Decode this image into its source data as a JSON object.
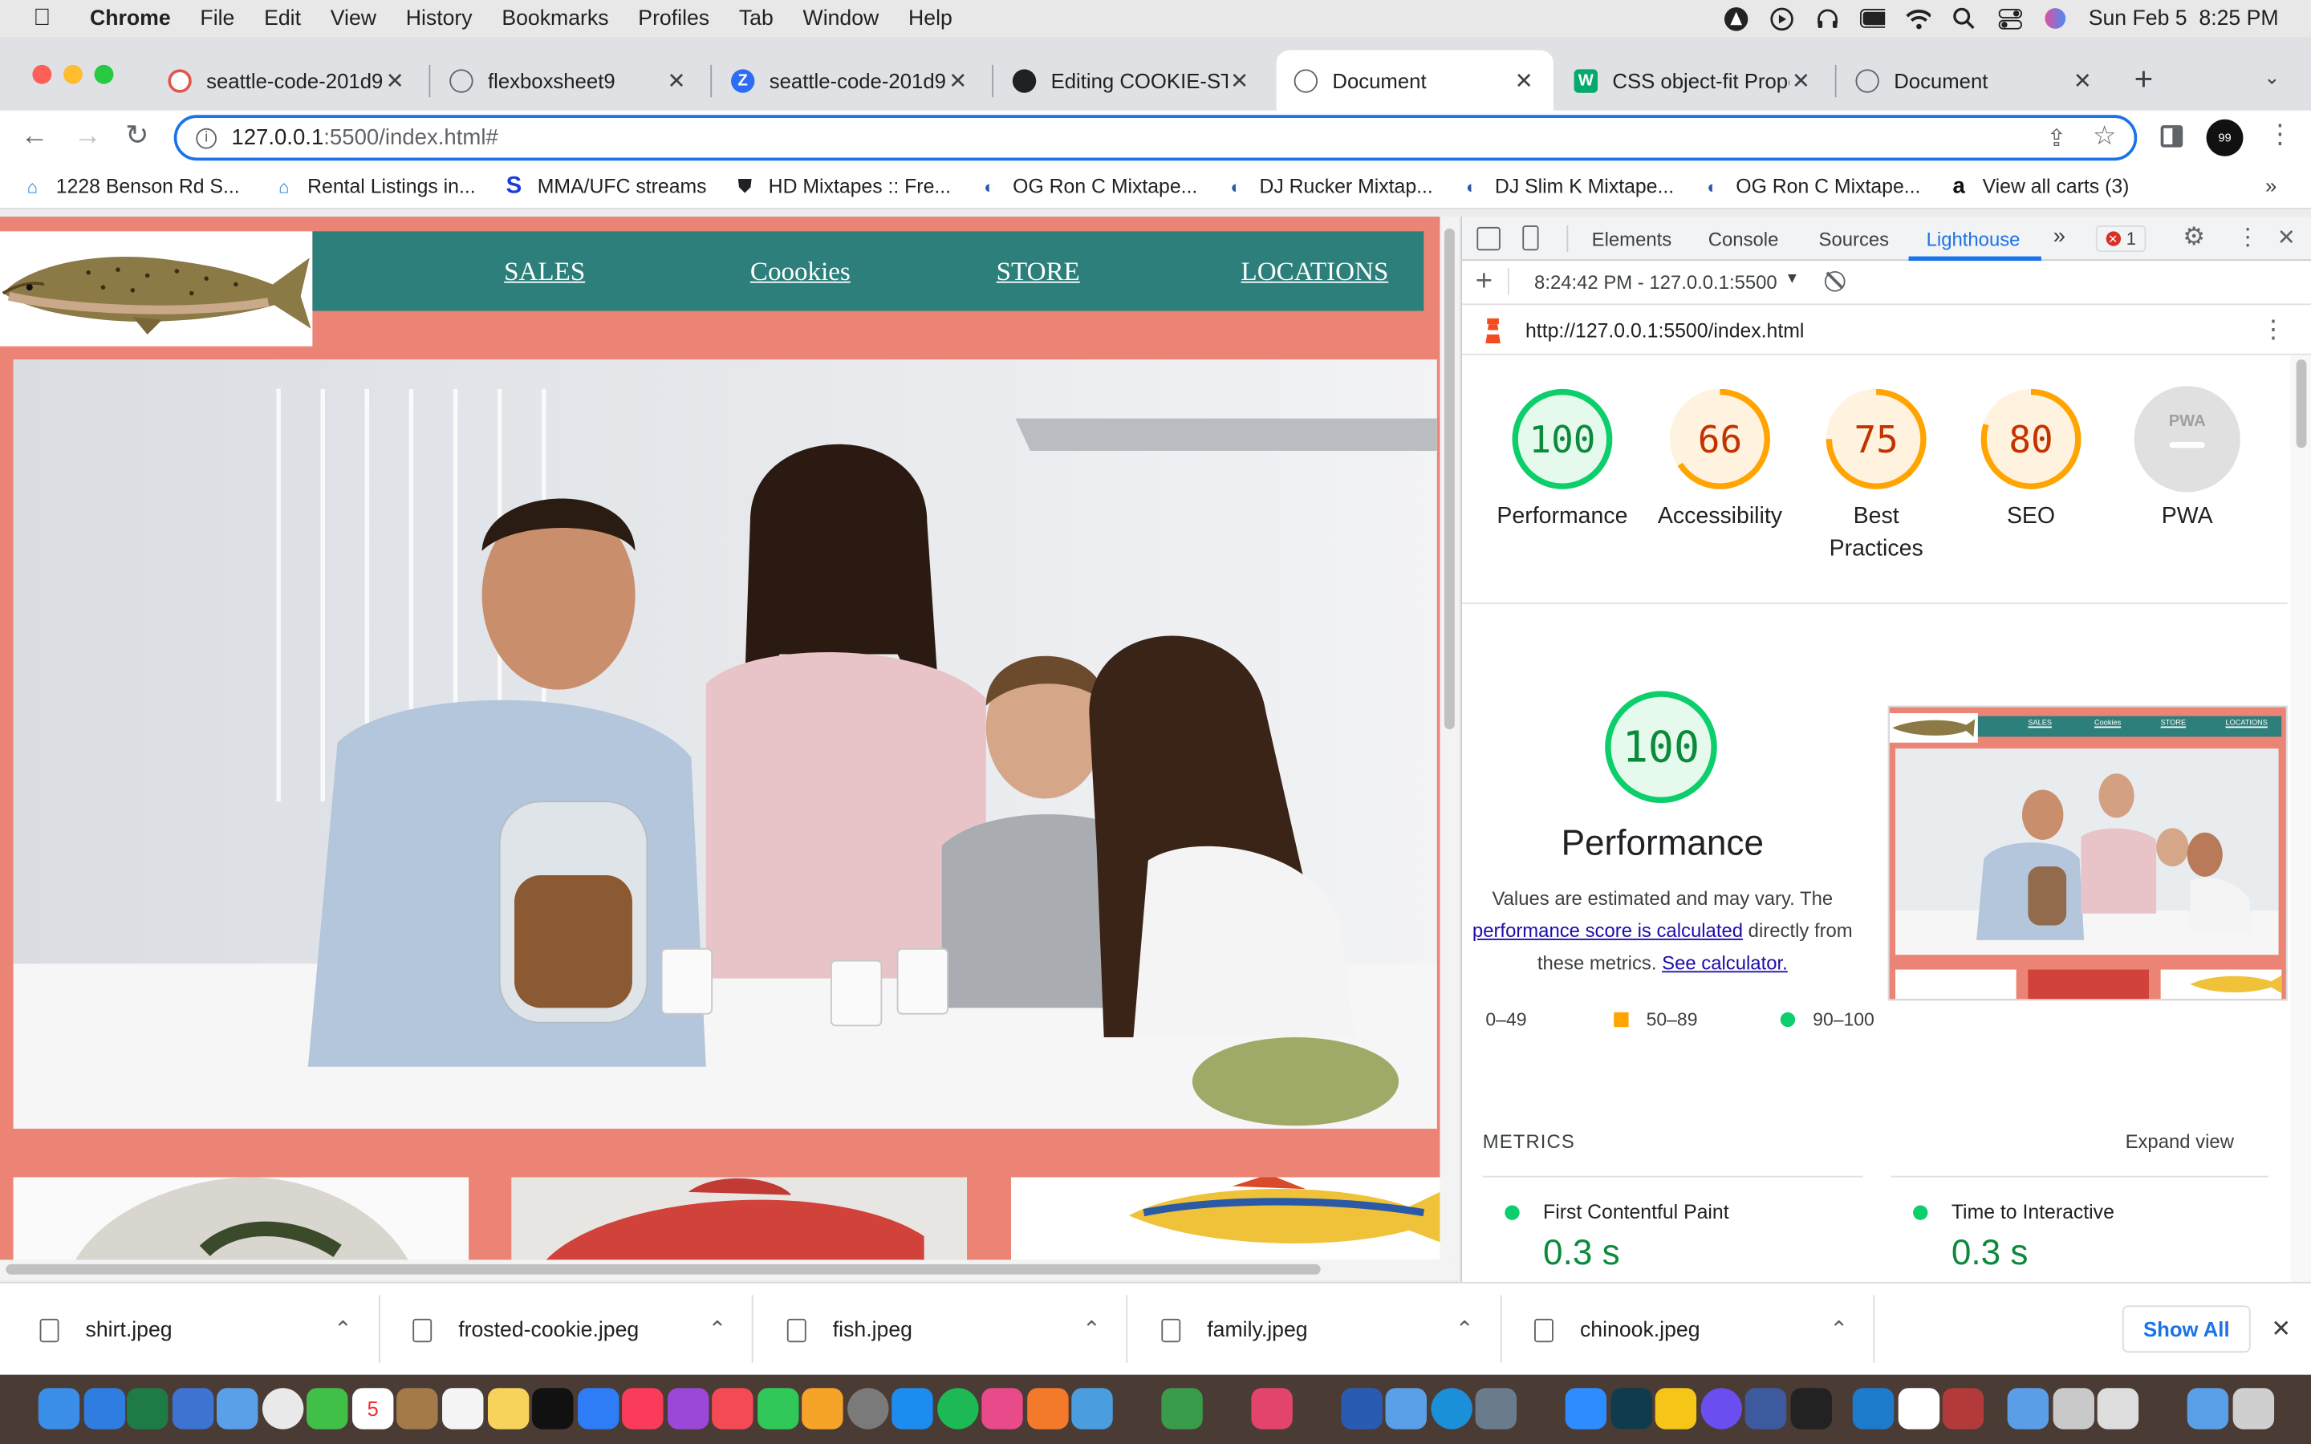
{
  "menubar": {
    "app": "Chrome",
    "items": [
      "File",
      "Edit",
      "View",
      "History",
      "Bookmarks",
      "Profiles",
      "Tab",
      "Window",
      "Help"
    ],
    "datetime": "Sun Feb 5  8:25 PM"
  },
  "tabs": [
    {
      "title": "seattle-code-201d9",
      "icon": "gear-red-icon"
    },
    {
      "title": "flexboxsheet9",
      "icon": "globe-icon"
    },
    {
      "title": "seattle-code-201d9",
      "icon": "zoom-icon"
    },
    {
      "title": "Editing COOKIE-STAND",
      "icon": "github-icon"
    },
    {
      "title": "Document",
      "icon": "globe-icon",
      "active": true
    },
    {
      "title": "CSS object-fit Property",
      "icon": "w3schools-icon"
    },
    {
      "title": "Document",
      "icon": "globe-icon"
    }
  ],
  "omnibox": {
    "host": "127.0.0.1",
    "path": ":5500/index.html#"
  },
  "bookmarks": [
    {
      "label": "1228 Benson Rd S...",
      "icon": "zillow-icon"
    },
    {
      "label": "Rental Listings in...",
      "icon": "zillow-icon"
    },
    {
      "label": "MMA/UFC streams",
      "icon": "streams-icon"
    },
    {
      "label": "HD Mixtapes :: Fre...",
      "icon": "shield-icon"
    },
    {
      "label": "OG Ron C Mixtape...",
      "icon": "mixtape-icon"
    },
    {
      "label": "DJ Rucker Mixtap...",
      "icon": "mixtape-icon"
    },
    {
      "label": "DJ Slim K Mixtape...",
      "icon": "mixtape-icon"
    },
    {
      "label": "OG Ron C Mixtape...",
      "icon": "mixtape-icon"
    },
    {
      "label": "View all carts (3)",
      "icon": "amazon-icon"
    }
  ],
  "site": {
    "nav": [
      "SALES",
      "Coookies",
      "STORE",
      "LOCATIONS"
    ]
  },
  "devtools": {
    "tabs": [
      "Elements",
      "Console",
      "Sources",
      "Lighthouse"
    ],
    "active_tab": "Lighthouse",
    "error_count": "1",
    "report_select": "8:24:42 PM - 127.0.0.1:5500",
    "report_url": "http://127.0.0.1:5500/index.html",
    "scores": [
      {
        "label": "Performance",
        "value": "100",
        "score": 100,
        "status": "pass"
      },
      {
        "label": "Accessibility",
        "value": "66",
        "score": 66,
        "status": "average"
      },
      {
        "label": "Best Practices",
        "value": "75",
        "score": 75,
        "status": "average"
      },
      {
        "label": "SEO",
        "value": "80",
        "score": 80,
        "status": "average"
      },
      {
        "label": "PWA",
        "value": "PWA",
        "score": null,
        "status": "na"
      }
    ],
    "perf": {
      "score": "100",
      "title": "Performance",
      "note_pre": "Values are estimated and may vary. The",
      "link1": "performance score is calculated",
      "note_mid": "directly from",
      "note_post": "these metrics.",
      "link2": "See calculator.",
      "legend": [
        "0–49",
        "50–89",
        "90–100"
      ]
    },
    "metrics_heading": "METRICS",
    "expand": "Expand view",
    "metrics": [
      {
        "name": "First Contentful Paint",
        "value": "0.3 s"
      },
      {
        "name": "Time to Interactive",
        "value": "0.3 s"
      }
    ],
    "thumb_nav": [
      "SALES",
      "Cookies",
      "STORE",
      "LOCATIONS"
    ]
  },
  "downloads": {
    "files": [
      "shirt.jpeg",
      "frosted-cookie.jpeg",
      "fish.jpeg",
      "family.jpeg",
      "chinook.jpeg"
    ],
    "show_all": "Show All"
  },
  "colors": {
    "page_bg": "#ec8476",
    "nav_bg": "#2c7f7a",
    "pass": "#0c8a3b",
    "average": "#c33300",
    "link": "#1a0dab"
  }
}
